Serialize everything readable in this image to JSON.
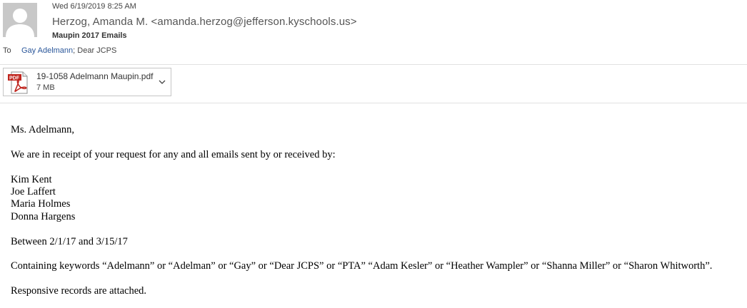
{
  "header": {
    "date": "Wed 6/19/2019 8:25 AM",
    "sender": "Herzog, Amanda M. <amanda.herzog@jefferson.kyschools.us>",
    "subject": "Maupin 2017 Emails",
    "to_label": "To",
    "recipients": [
      "Gay Adelmann",
      "Dear JCPS"
    ],
    "recipient_separator": ";"
  },
  "attachment": {
    "name": "19-1058 Adelmann Maupin.pdf",
    "size": "7 MB",
    "type_label": "PDF",
    "icon": "pdf-file-icon"
  },
  "body": {
    "greeting": "Ms. Adelmann,",
    "intro": "We are in receipt of your request for any and all emails sent by or received by:",
    "names": [
      "Kim Kent",
      "Joe Laffert",
      "Maria Holmes",
      "Donna Hargens"
    ],
    "date_range": "Between 2/1/17 and 3/15/17",
    "keywords": "Containing keywords “Adelmann” or “Adelman” or “Gay” or “Dear JCPS” or “PTA” “Adam Kesler” or “Heather Wampler” or “Shanna Miller” or “Sharon Whitworth”.",
    "closing": "Responsive records are attached."
  },
  "colors": {
    "recipient_link": "#2b579a",
    "pdf_red": "#c0261f",
    "avatar_bg": "#c8c8c8"
  }
}
